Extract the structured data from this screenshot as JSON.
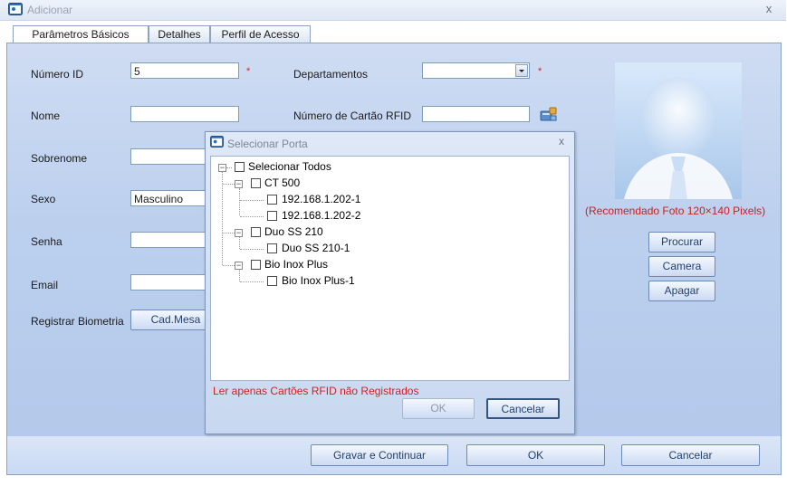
{
  "window": {
    "title": "Adicionar",
    "close_symbol": "x"
  },
  "tabs": [
    {
      "label": "Parâmetros Básicos",
      "active": true
    },
    {
      "label": "Detalhes",
      "active": false
    },
    {
      "label": "Perfil de Acesso",
      "active": false
    }
  ],
  "form": {
    "numero_id": {
      "label": "Número ID",
      "value": "5",
      "required_mark": "*"
    },
    "nome": {
      "label": "Nome",
      "value": ""
    },
    "sobrenome": {
      "label": "Sobrenome",
      "value": ""
    },
    "sexo": {
      "label": "Sexo",
      "value": "Masculino"
    },
    "senha": {
      "label": "Senha",
      "value": ""
    },
    "email": {
      "label": "Email",
      "value": ""
    },
    "registrar_biometria": {
      "label": "Registrar Biometria",
      "button": "Cad.Mesa"
    },
    "departamentos": {
      "label": "Departamentos",
      "value": "",
      "required_mark": "*"
    },
    "cartao_rfid": {
      "label": "Número de Cartão RFID",
      "value": ""
    }
  },
  "photo": {
    "note": "(Recomendado Foto 120×140 Pixels)",
    "buttons": {
      "procurar": "Procurar",
      "camera": "Camera",
      "apagar": "Apagar"
    }
  },
  "footer": {
    "save_continue": "Gravar e Continuar",
    "ok": "OK",
    "cancel": "Cancelar"
  },
  "dialog": {
    "title": "Selecionar Porta",
    "close_symbol": "x",
    "tree": {
      "root": "Selecionar Todos",
      "groups": [
        {
          "label": "CT 500",
          "children": [
            "192.168.1.202-1",
            "192.168.1.202-2"
          ]
        },
        {
          "label": "Duo SS 210",
          "children": [
            "Duo SS 210-1"
          ]
        },
        {
          "label": "Bio Inox Plus",
          "children": [
            "Bio Inox Plus-1"
          ]
        }
      ]
    },
    "note": "Ler apenas Cartões RFID não Registrados",
    "ok": "OK",
    "cancel": "Cancelar"
  },
  "colors": {
    "accent": "#b4c9eb",
    "warning_text": "#d22020",
    "button_text": "#24416f"
  }
}
